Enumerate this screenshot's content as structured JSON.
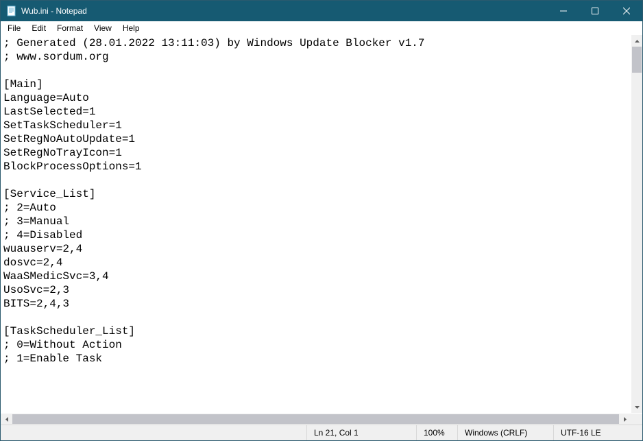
{
  "window": {
    "title": "Wub.ini - Notepad"
  },
  "menu": {
    "file": "File",
    "edit": "Edit",
    "format": "Format",
    "view": "View",
    "help": "Help"
  },
  "content": "; Generated (28.01.2022 13:11:03) by Windows Update Blocker v1.7\n; www.sordum.org\n\n[Main]\nLanguage=Auto\nLastSelected=1\nSetTaskScheduler=1\nSetRegNoAutoUpdate=1\nSetRegNoTrayIcon=1\nBlockProcessOptions=1\n\n[Service_List]\n; 2=Auto\n; 3=Manual\n; 4=Disabled\nwuauserv=2,4\ndosvc=2,4\nWaaSMedicSvc=3,4\nUsoSvc=2,3\nBITS=2,4,3\n\n[TaskScheduler_List]\n; 0=Without Action\n; 1=Enable Task",
  "status": {
    "position": "Ln 21, Col 1",
    "zoom": "100%",
    "line_ending": "Windows (CRLF)",
    "encoding": "UTF-16 LE"
  }
}
